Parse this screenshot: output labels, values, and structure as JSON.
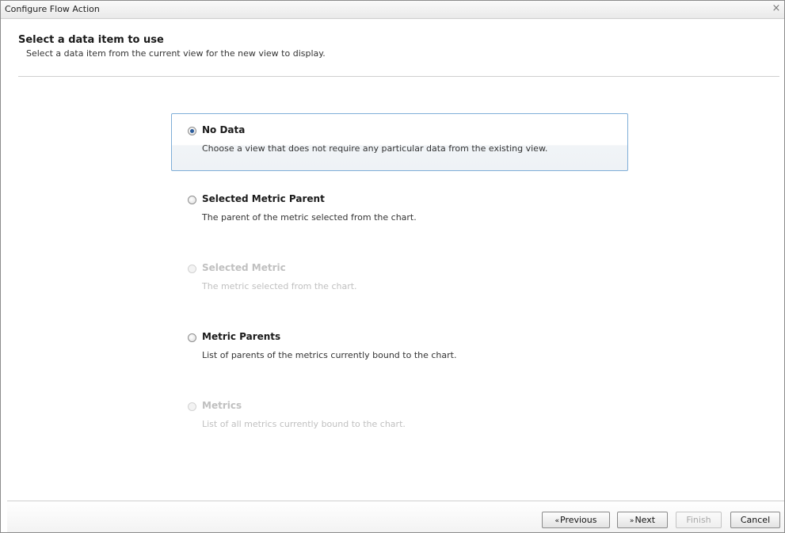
{
  "window": {
    "title": "Configure Flow Action",
    "close_glyph": "×"
  },
  "header": {
    "title": "Select a data item to use",
    "subtitle": "Select a data item from the current view for the new view to display."
  },
  "options": [
    {
      "label": "No Data",
      "description": "Choose a view that does not require any particular data from the existing view.",
      "selected": true,
      "enabled": true
    },
    {
      "label": "Selected Metric Parent",
      "description": "The parent of the metric selected from the chart.",
      "selected": false,
      "enabled": true
    },
    {
      "label": "Selected Metric",
      "description": "The metric selected from the chart.",
      "selected": false,
      "enabled": false
    },
    {
      "label": "Metric Parents",
      "description": "List of parents of the metrics currently bound to the chart.",
      "selected": false,
      "enabled": true
    },
    {
      "label": "Metrics",
      "description": "List of all metrics currently bound to the chart.",
      "selected": false,
      "enabled": false
    }
  ],
  "buttons": {
    "previous_arrow": "«",
    "previous": "Previous",
    "next_arrow": "»",
    "next": "Next",
    "finish": "Finish",
    "cancel": "Cancel"
  },
  "colors": {
    "selection_border": "#7faed8",
    "radio_dot": "#2c5d9c"
  }
}
